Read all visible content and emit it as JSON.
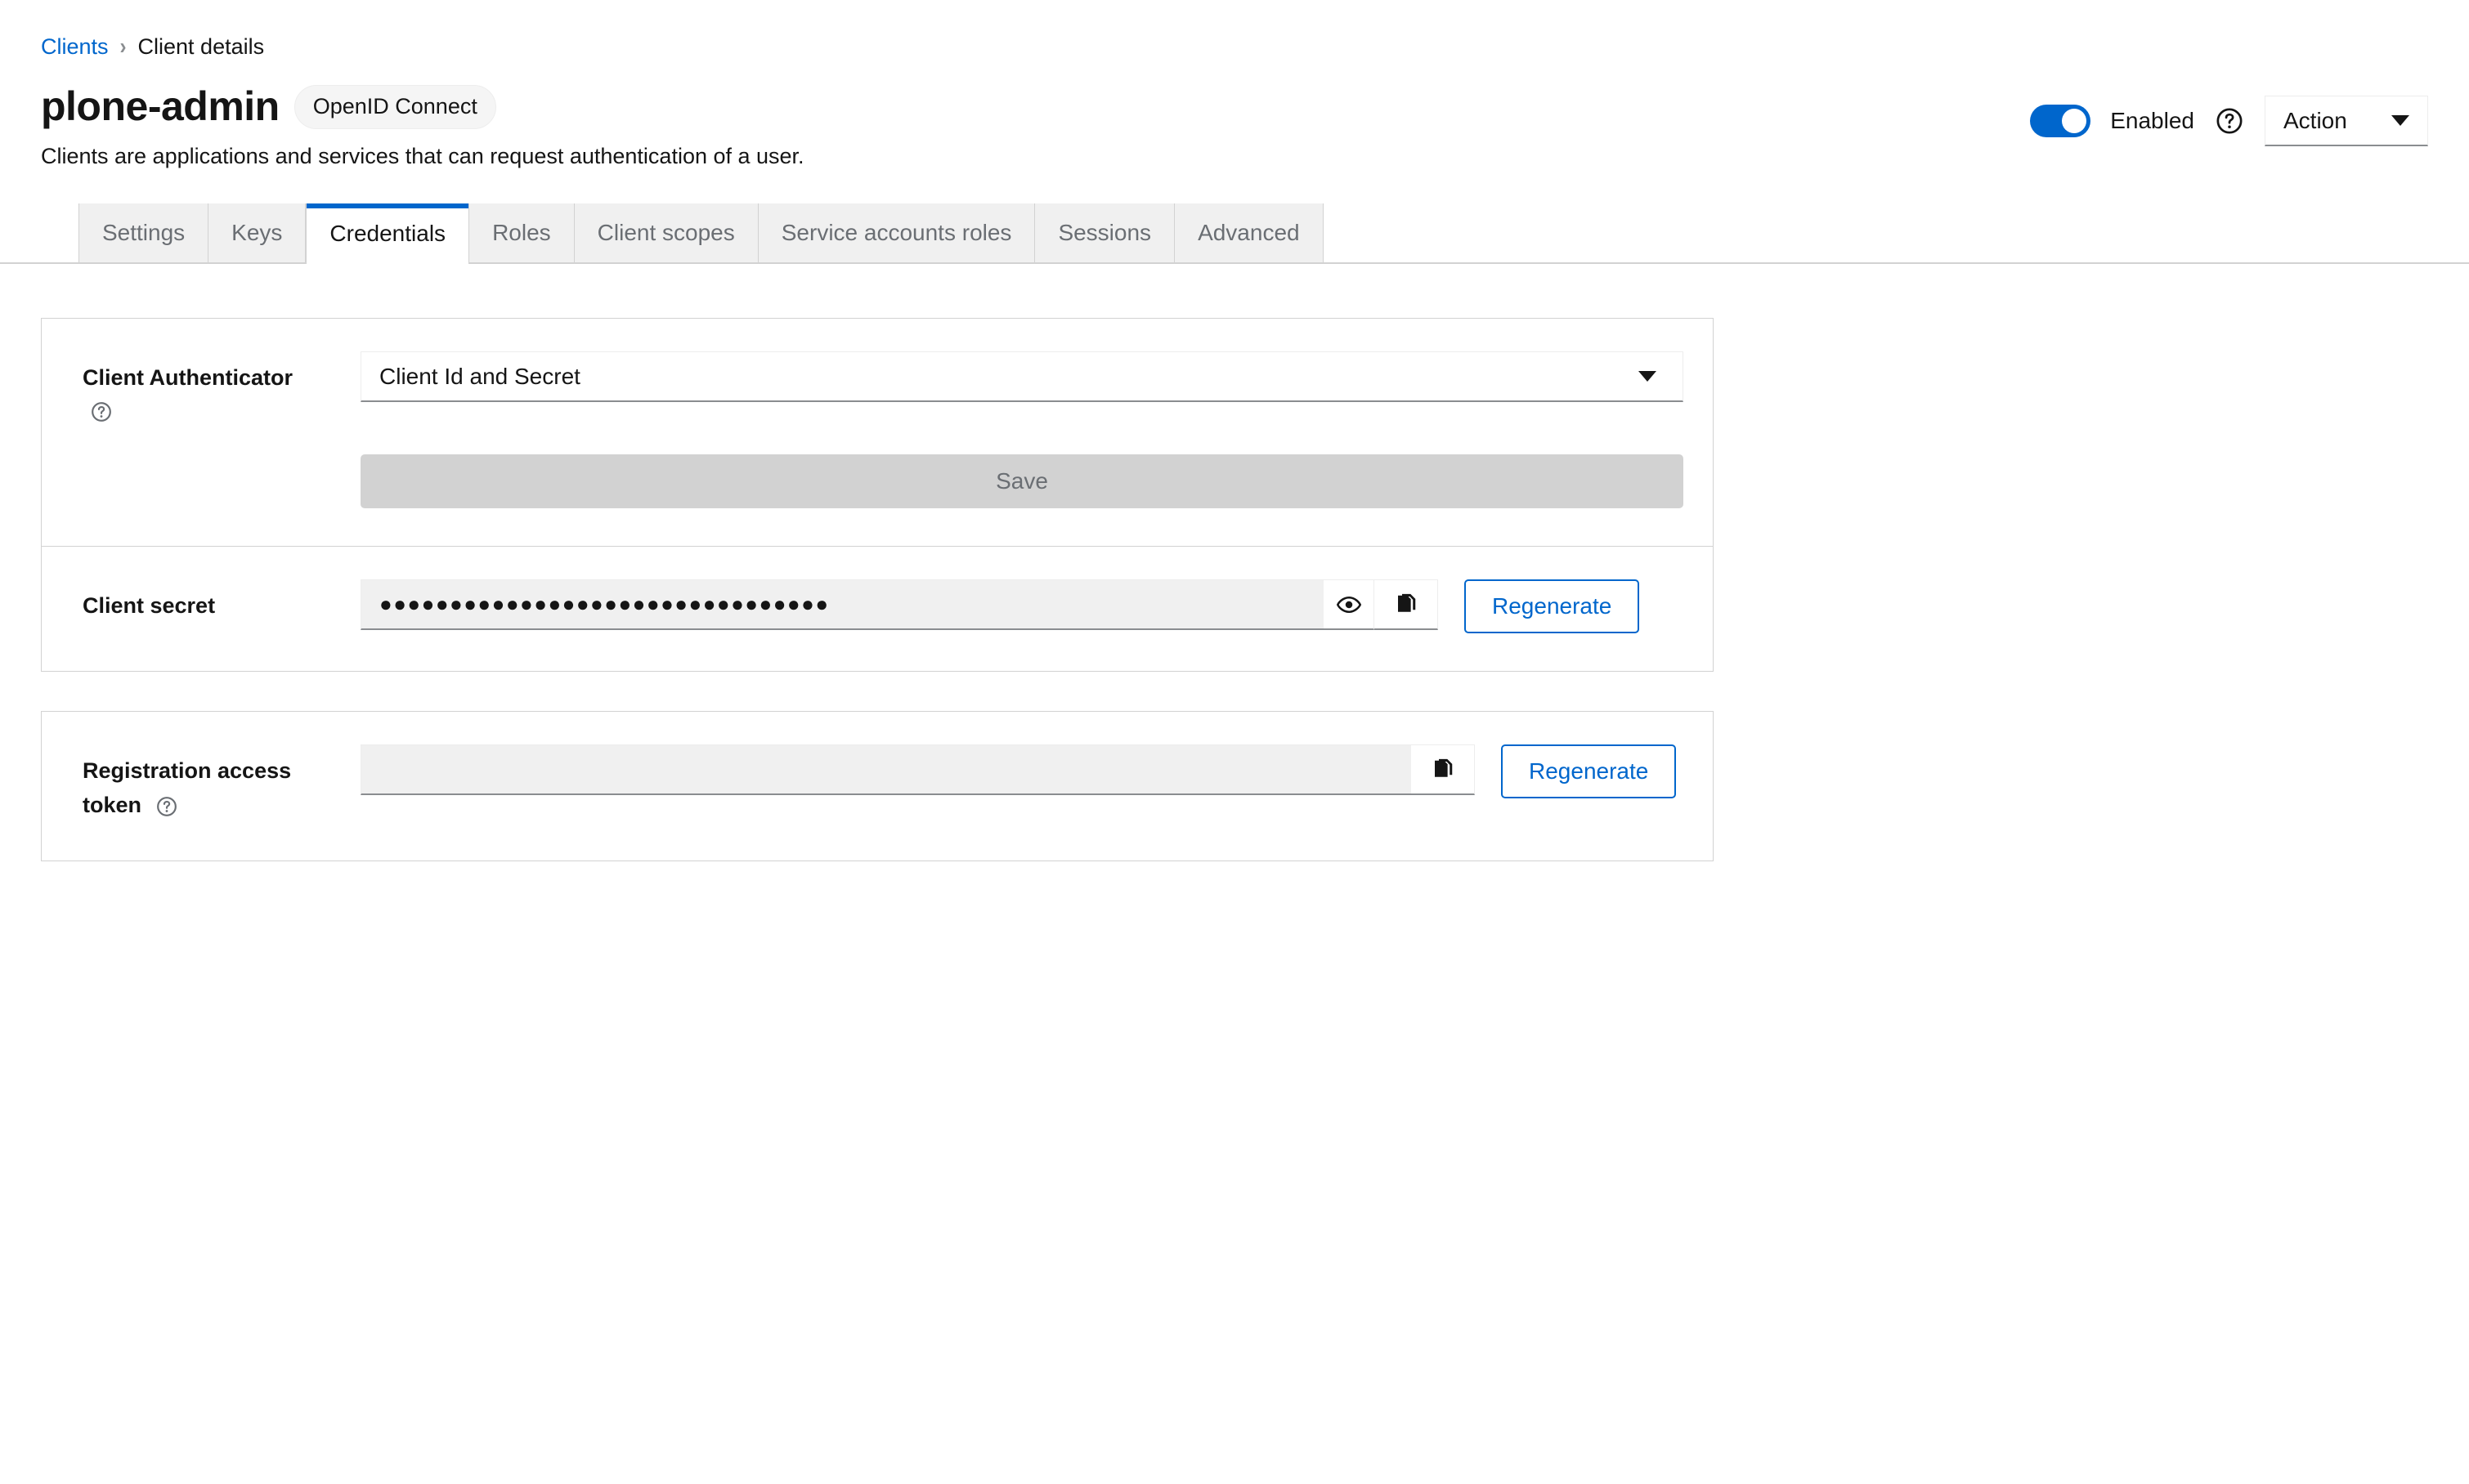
{
  "breadcrumb": {
    "parent": "Clients",
    "separator": "›",
    "current": "Client details"
  },
  "header": {
    "title": "plone-admin",
    "protocol_badge": "OpenID Connect",
    "subtitle": "Clients are applications and services that can request authentication of a user.",
    "enabled_label": "Enabled",
    "enabled": true,
    "help_icon": "help-circle-icon",
    "action_label": "Action",
    "action_caret_icon": "caret-down-icon"
  },
  "tabs": [
    {
      "label": "Settings",
      "active": false
    },
    {
      "label": "Keys",
      "active": false
    },
    {
      "label": "Credentials",
      "active": true
    },
    {
      "label": "Roles",
      "active": false
    },
    {
      "label": "Client scopes",
      "active": false
    },
    {
      "label": "Service accounts roles",
      "active": false
    },
    {
      "label": "Sessions",
      "active": false
    },
    {
      "label": "Advanced",
      "active": false
    }
  ],
  "credentials": {
    "authenticator": {
      "label": "Client Authenticator",
      "help_icon": "help-circle-icon",
      "selected": "Client Id and Secret",
      "caret_icon": "caret-down-icon",
      "save_label": "Save",
      "save_disabled": true
    },
    "client_secret": {
      "label": "Client secret",
      "value_masked": "●●●●●●●●●●●●●●●●●●●●●●●●●●●●●●●●",
      "show_icon": "eye-icon",
      "copy_icon": "copy-icon",
      "regenerate_label": "Regenerate"
    },
    "registration_access_token": {
      "label_line1": "Registration access",
      "label_line2": "token",
      "help_icon": "help-circle-icon",
      "value": "",
      "copy_icon": "copy-icon",
      "regenerate_label": "Regenerate"
    }
  },
  "colors": {
    "accent_blue": "#0066cc",
    "toggle_on": "#0066cc",
    "border": "#d2d2d2",
    "readonly_bg": "#f0f0f0",
    "disabled_bg": "#d2d2d2",
    "text": "#151515",
    "muted_text": "#6a6e73"
  }
}
